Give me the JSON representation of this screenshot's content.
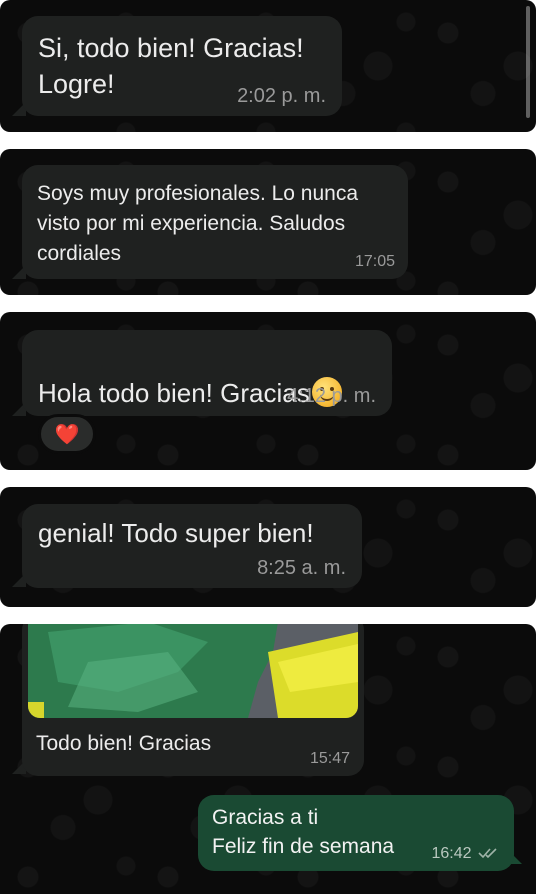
{
  "messages": [
    {
      "text": "Si, todo bien! Gracias!\nLogre!",
      "time": "2:02 p. m."
    },
    {
      "text": "Soys muy profesionales. Lo nunca\nvisto por mi experiencia. Saludos\ncordiales",
      "time": "17:05"
    },
    {
      "text": "Hola todo bien! Gracias",
      "emoji": "smiling-face",
      "time": "4:12 p. m.",
      "reaction": "❤️"
    },
    {
      "text": "genial! Todo super bien!",
      "time": "8:25 a. m."
    },
    {
      "caption": "Todo bien! Gracias",
      "time": "15:47"
    },
    {
      "text": "Gracias a ti\nFeliz fin de semana",
      "time": "16:42",
      "status_icon": "double-check-icon"
    }
  ],
  "colors": {
    "background": "#0b0b0b",
    "incoming_bubble": "#1f2120",
    "outgoing_bubble": "#1a4a33",
    "timestamp": "#9a9a9a",
    "read_ticks": "#9fb3a8"
  }
}
